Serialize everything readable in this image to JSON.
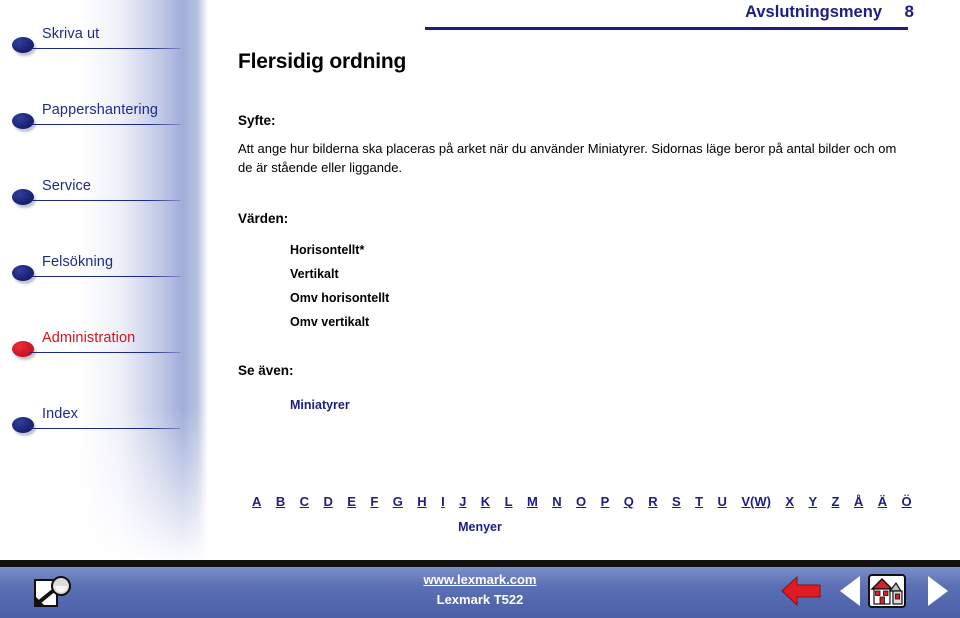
{
  "header": {
    "title": "Avslutningsmeny",
    "page_number": "8",
    "rule_color": "#1d1d86"
  },
  "sidebar": {
    "items": [
      {
        "label": "Skriva ut",
        "icon": "bullet-icon",
        "current": false
      },
      {
        "label": "Pappershantering",
        "icon": "bullet-icon",
        "current": false
      },
      {
        "label": "Service",
        "icon": "bullet-icon",
        "current": false
      },
      {
        "label": "Felsökning",
        "icon": "bullet-icon",
        "current": false
      },
      {
        "label": "Administration",
        "icon": "bullet-icon",
        "current": true
      },
      {
        "label": "Index",
        "icon": "bullet-icon",
        "current": false
      }
    ],
    "link_color": "#1d2a8c",
    "current_color": "#d8121b"
  },
  "main": {
    "doc_title": "Flersidig ordning",
    "purpose_heading": "Syfte:",
    "purpose_body": "Att ange hur bilderna ska placeras på arket när du använder Miniatyrer. Sidornas läge beror på antal bilder och om de är stående eller liggande.",
    "values_heading": "Värden:",
    "values": [
      "Horisontellt*",
      "Vertikalt",
      "Omv horisontellt",
      "Omv vertikalt"
    ],
    "see_also_heading": "Se även:",
    "see_also_link": "Miniatyrer"
  },
  "alpha_index": {
    "letters": [
      "A",
      "B",
      "C",
      "D",
      "E",
      "F",
      "G",
      "H",
      "I",
      "J",
      "K",
      "L",
      "M",
      "N",
      "O",
      "P",
      "Q",
      "R",
      "S",
      "T",
      "U",
      "V(W)",
      "X",
      "Y",
      "Z",
      "Å",
      "Ä",
      "Ö"
    ],
    "menu_link": "Menyer",
    "link_color": "#1d1d86"
  },
  "footer": {
    "url": "www.lexmark.com",
    "model": "Lexmark T522",
    "band_color": "#5b70b4",
    "buttons": [
      {
        "name": "search-icon",
        "label": "Sök"
      },
      {
        "name": "back-arrow-icon",
        "label": "Tillbaka"
      },
      {
        "name": "previous-icon",
        "label": "Föregående"
      },
      {
        "name": "home-icon",
        "label": "Hem"
      },
      {
        "name": "next-icon",
        "label": "Nästa"
      }
    ]
  }
}
